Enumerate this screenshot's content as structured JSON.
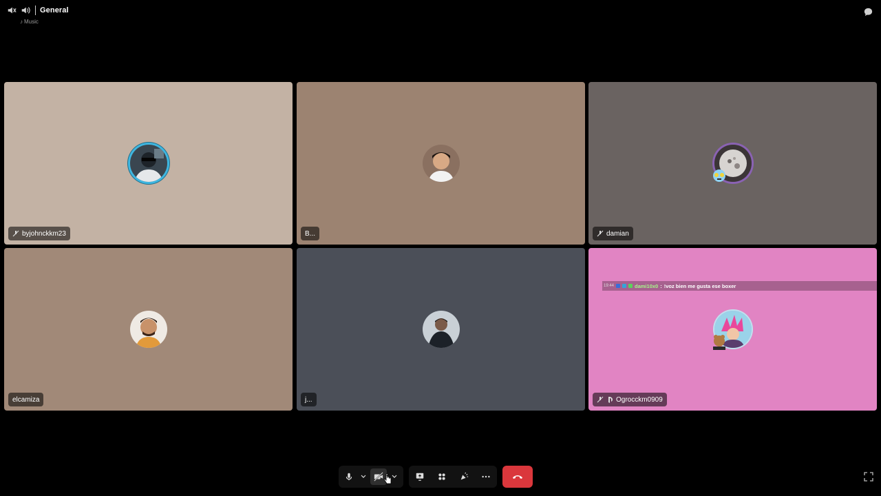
{
  "header": {
    "channel_name": "General",
    "activity": "Music",
    "icons": [
      "speaker-muted-icon",
      "speaker-icon",
      "chat-icon"
    ]
  },
  "tiles": [
    {
      "name": "byjohnckkm23",
      "bg": "#c3b2a4",
      "muted": true
    },
    {
      "name": "B...",
      "bg": "#9c8371",
      "muted": false
    },
    {
      "name": "damian",
      "bg": "#6a6361",
      "muted": true
    },
    {
      "name": "elcamiza",
      "bg": "#a18978",
      "muted": false
    },
    {
      "name": "j...",
      "bg": "#4b4f58",
      "muted": false
    },
    {
      "name": "Ogrocckm0909",
      "bg": "#e184c3",
      "muted": true,
      "game_icon": "playstation-icon"
    }
  ],
  "stream_chat": {
    "time": "19:44",
    "user": "dami10x0",
    "message": "!voz bien me gusta ese boxer"
  },
  "controls": {
    "buttons": [
      "microphone",
      "mic-options",
      "camera-off",
      "camera-options",
      "screen-share",
      "activities",
      "soundboard",
      "more",
      "disconnect",
      "fullscreen"
    ],
    "disconnect_color": "#da373c"
  }
}
